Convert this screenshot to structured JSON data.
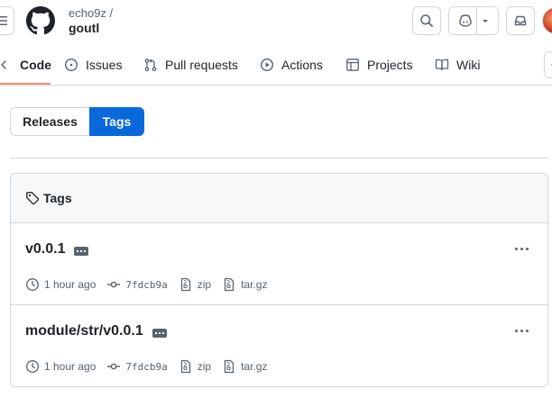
{
  "header": {
    "owner": "echo9z /",
    "repo": "goutl"
  },
  "nav": {
    "tabs": [
      {
        "label": "Code",
        "icon": "code-icon",
        "active": true
      },
      {
        "label": "Issues",
        "icon": "issue-icon"
      },
      {
        "label": "Pull requests",
        "icon": "pull-request-icon"
      },
      {
        "label": "Actions",
        "icon": "play-icon"
      },
      {
        "label": "Projects",
        "icon": "table-icon"
      },
      {
        "label": "Wiki",
        "icon": "book-icon"
      }
    ]
  },
  "segmented": {
    "releases_label": "Releases",
    "tags_label": "Tags",
    "selected": "Tags"
  },
  "tags_box": {
    "title": "Tags",
    "tags": [
      {
        "name": "v0.0.1",
        "time": "1 hour ago",
        "commit": "7fdcb9a",
        "zip": "zip",
        "targz": "tar.gz"
      },
      {
        "name": "module/str/v0.0.1",
        "time": "1 hour ago",
        "commit": "7fdcb9a",
        "zip": "zip",
        "targz": "tar.gz"
      }
    ]
  },
  "colors": {
    "accent": "#0969da",
    "tab_underline": "#fd8c73",
    "border": "#d0d7de",
    "muted": "#59636e"
  }
}
